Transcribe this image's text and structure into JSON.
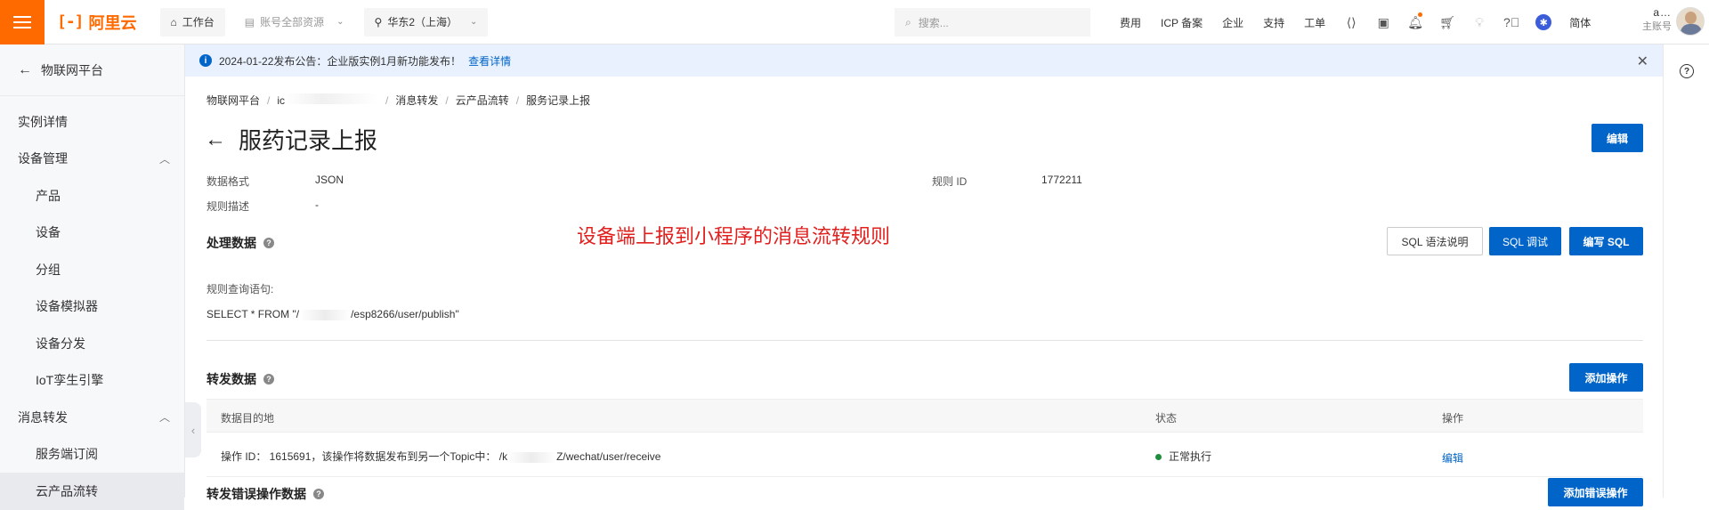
{
  "topbar": {
    "logo_text": "阿里云",
    "workbench": "工作台",
    "account_resources": "账号全部资源",
    "region": "华东2（上海）",
    "search_placeholder": "搜索...",
    "links": [
      "费用",
      "ICP 备案",
      "企业",
      "支持",
      "工单"
    ],
    "language": "简体",
    "account_name": "a…",
    "account_sub": "主账号"
  },
  "sidebar": {
    "back_label": "物联网平台",
    "items": [
      {
        "label": "实例详情"
      },
      {
        "label": "设备管理"
      },
      {
        "label": "产品"
      },
      {
        "label": "设备"
      },
      {
        "label": "分组"
      },
      {
        "label": "设备模拟器"
      },
      {
        "label": "设备分发"
      },
      {
        "label": "IoT孪生引擎"
      },
      {
        "label": "消息转发"
      },
      {
        "label": "服务端订阅"
      },
      {
        "label": "云产品流转"
      }
    ]
  },
  "notice": {
    "text": "2024-01-22发布公告：企业版实例1月新功能发布！",
    "link": "查看详情"
  },
  "breadcrumb": [
    "物联网平台",
    "ic",
    "消息转发",
    "云产品流转",
    "服务记录上报"
  ],
  "page": {
    "title": "服药记录上报",
    "edit_button": "编辑",
    "data_format_label": "数据格式",
    "data_format_value": "JSON",
    "rule_id_label": "规则 ID",
    "rule_id_value": "1772211",
    "rule_desc_label": "规则描述",
    "rule_desc_value": "-"
  },
  "annotation": "设备端上报到小程序的消息流转规则",
  "process_section": {
    "title": "处理数据",
    "sql_help_button": "SQL 语法说明",
    "sql_debug_button": "SQL 调试",
    "sql_write_button": "编写 SQL",
    "query_label": "规则查询语句:",
    "query_prefix": "SELECT * FROM \"/",
    "query_suffix": "/esp8266/user/publish\""
  },
  "forward_section": {
    "title": "转发数据",
    "add_button": "添加操作",
    "columns": [
      "数据目的地",
      "状态",
      "操作"
    ],
    "rows": [
      {
        "destination_prefix": "操作 ID： 1615691，该操作将数据发布到另一个Topic中： /k",
        "destination_suffix": "Z/wechat/user/receive",
        "status": "正常执行",
        "action": "编辑"
      }
    ]
  },
  "error_section": {
    "title": "转发错误操作数据",
    "add_button": "添加错误操作"
  },
  "colors": {
    "brand": "#ff6a00",
    "primary": "#0064c8",
    "annotation": "#e0201e",
    "status_ok": "#1e8e3e"
  }
}
